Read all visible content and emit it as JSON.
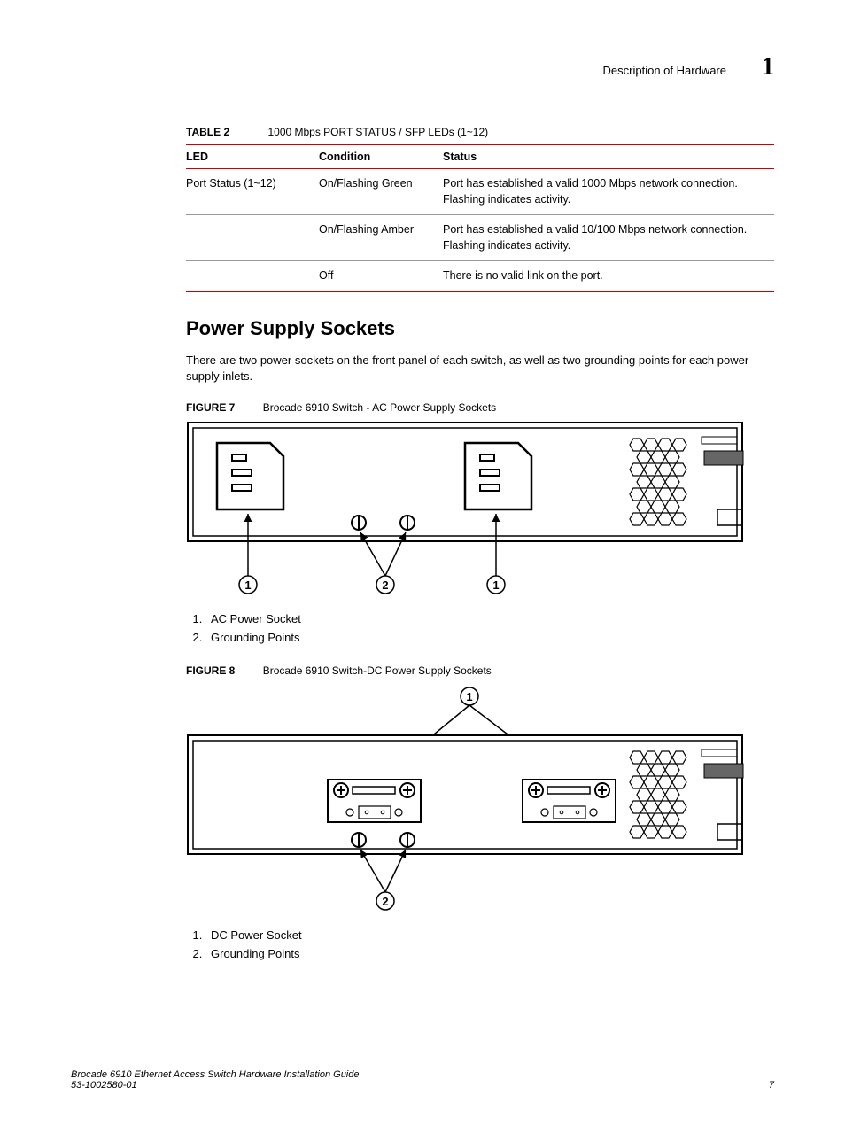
{
  "header": {
    "section": "Description of Hardware",
    "chapter": "1"
  },
  "table2": {
    "label": "TABLE 2",
    "title": "1000 Mbps PORT STATUS / SFP LEDs (1~12)",
    "headers": {
      "c1": "LED",
      "c2": "Condition",
      "c3": "Status"
    },
    "rows": [
      {
        "led": "Port Status (1~12)",
        "condition": "On/Flashing Green",
        "status": "Port has established a valid 1000 Mbps network connection. Flashing indicates activity."
      },
      {
        "led": "",
        "condition": "On/Flashing Amber",
        "status": "Port has established a valid 10/100 Mbps network connection. Flashing indicates activity."
      },
      {
        "led": "",
        "condition": "Off",
        "status": "There is no valid link on the port."
      }
    ]
  },
  "section_heading": "Power Supply Sockets",
  "section_paragraph": "There are two power sockets on the front panel of each switch, as well as two grounding points for each power supply inlets.",
  "figure7": {
    "label": "FIGURE 7",
    "title": "Brocade 6910 Switch - AC Power Supply Sockets",
    "legend": [
      "AC Power Socket",
      "Grounding Points"
    ],
    "callouts": {
      "a": "1",
      "b": "2",
      "c": "1"
    }
  },
  "figure8": {
    "label": "FIGURE 8",
    "title": "Brocade 6910 Switch-DC Power Supply Sockets",
    "legend": [
      "DC Power Socket",
      "Grounding Points"
    ],
    "callouts": {
      "top": "1",
      "bottom": "2"
    }
  },
  "footer": {
    "doc_title": "Brocade 6910 Ethernet Access Switch Hardware Installation Guide",
    "doc_num": "53-1002580-01",
    "page": "7"
  }
}
